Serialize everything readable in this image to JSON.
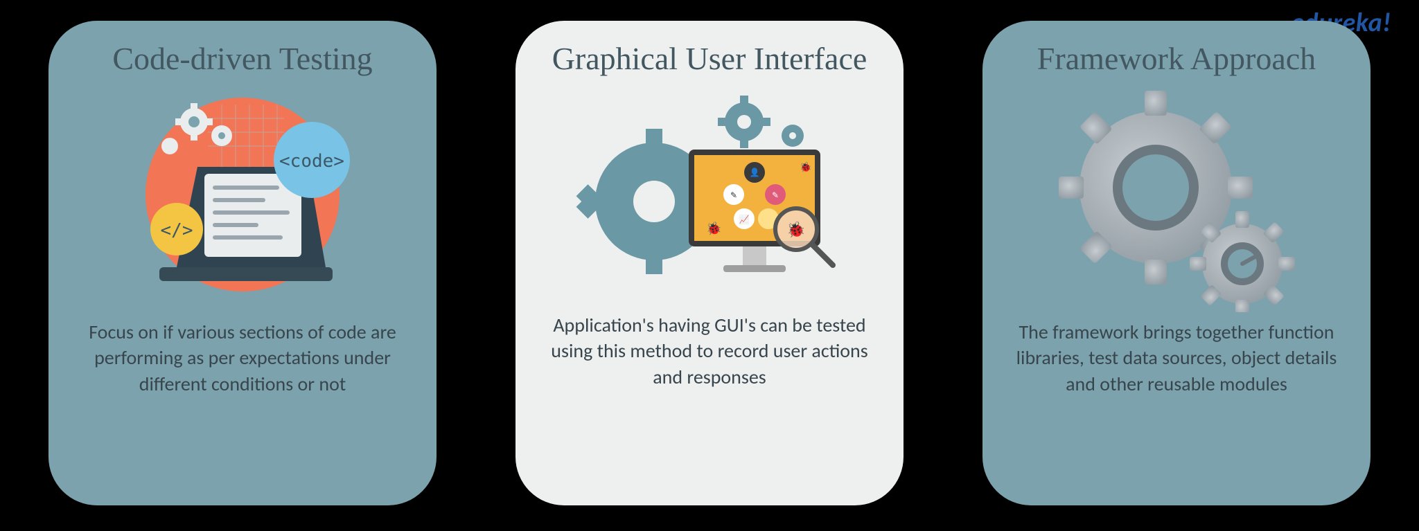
{
  "brand": "edureka!",
  "cards": [
    {
      "title": "Code-driven Testing",
      "desc": "Focus on if various sections of code are performing as per expectations under different conditions or not"
    },
    {
      "title": "Graphical User Interface",
      "desc": "Application's having GUI's can be tested using this method to record user actions and responses"
    },
    {
      "title": "Framework Approach",
      "desc": "The framework brings together function libraries, test data sources, object details and other reusable modules"
    }
  ]
}
